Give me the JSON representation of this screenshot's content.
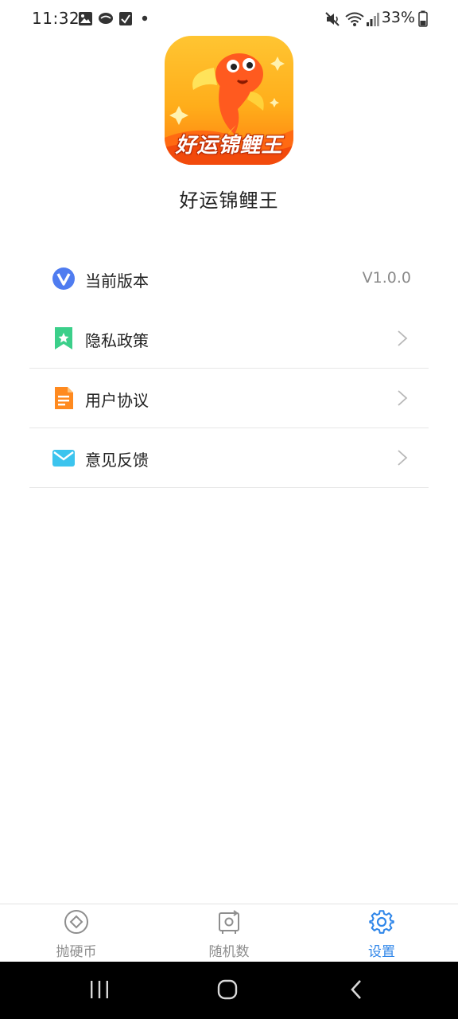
{
  "status_bar": {
    "time": "11:32",
    "battery": "33%",
    "icons": [
      "image-icon",
      "chat-bubble-icon",
      "checkbox-icon",
      "dot-icon",
      "mute-icon",
      "wifi-icon",
      "signal-icon",
      "battery-icon"
    ]
  },
  "app": {
    "icon_text": "好运锦鲤王",
    "name": "好运锦鲤王"
  },
  "settings": {
    "items": [
      {
        "label": "当前版本",
        "value": "V1.0.0",
        "icon": "version-icon"
      },
      {
        "label": "隐私政策",
        "icon": "privacy-icon"
      },
      {
        "label": "用户协议",
        "icon": "agreement-icon"
      },
      {
        "label": "意见反馈",
        "icon": "feedback-icon"
      }
    ]
  },
  "bottom_nav": {
    "items": [
      {
        "label": "抛硬币",
        "icon": "coin-icon",
        "active": false
      },
      {
        "label": "随机数",
        "icon": "random-icon",
        "active": false
      },
      {
        "label": "设置",
        "icon": "gear-icon",
        "active": true
      }
    ]
  },
  "colors": {
    "accent": "#2f86e9",
    "inactive": "#8e8e8e",
    "divider": "#e6e6e6"
  }
}
